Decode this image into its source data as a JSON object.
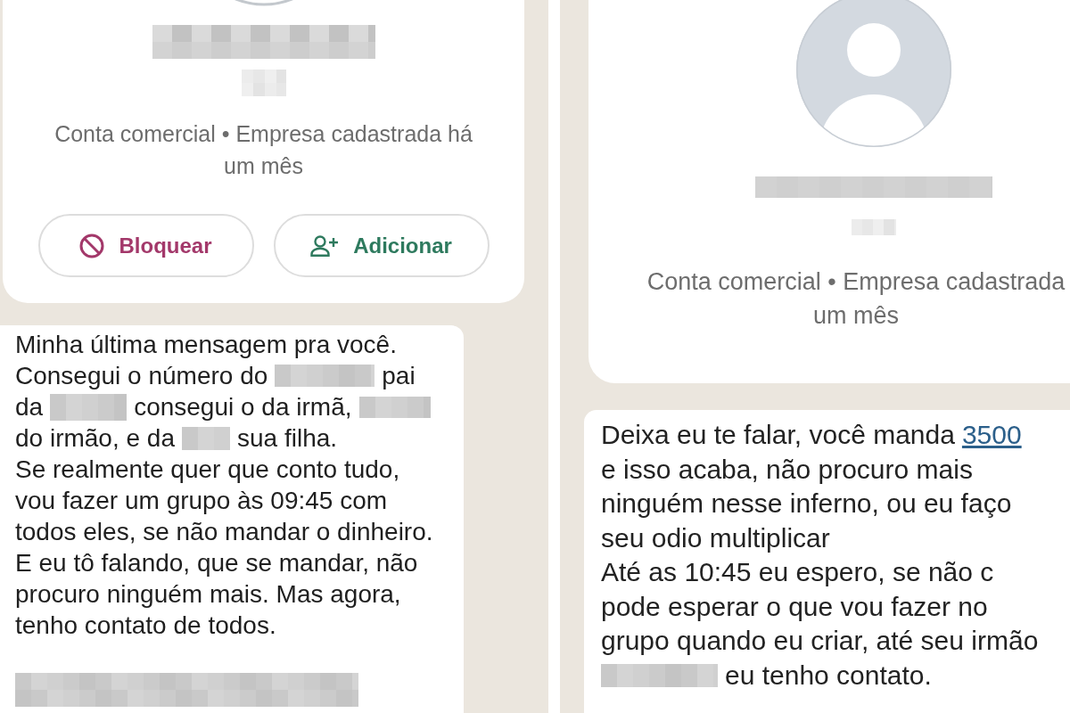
{
  "left_screen": {
    "profile_card": {
      "subtitle_lines": [
        "Conta comercial • Empresa cadastrada há",
        "um mês"
      ],
      "buttons": [
        {
          "kind": "block",
          "label": "Bloquear"
        },
        {
          "kind": "add",
          "label": "Adicionar"
        }
      ]
    },
    "message": {
      "lines": [
        [
          {
            "kind": "text",
            "text": "Minha última mensagem pra você."
          }
        ],
        [
          {
            "kind": "text",
            "text": "Consegui o número do"
          },
          {
            "kind": "redacted"
          },
          {
            "kind": "text",
            "text": "pai"
          }
        ],
        [
          {
            "kind": "text",
            "text": "da"
          },
          {
            "kind": "redacted"
          },
          {
            "kind": "text",
            "text": "consegui o da irmã,"
          },
          {
            "kind": "redacted"
          }
        ],
        [
          {
            "kind": "text",
            "text": "do irmão, e da"
          },
          {
            "kind": "redacted"
          },
          {
            "kind": "text",
            "text": "sua filha."
          }
        ],
        [
          {
            "kind": "text",
            "text": "Se realmente quer que conto tudo,"
          }
        ],
        [
          {
            "kind": "text",
            "text": "vou fazer um grupo às 09:45 com"
          }
        ],
        [
          {
            "kind": "text",
            "text": "todos eles, se não mandar o dinheiro."
          }
        ],
        [
          {
            "kind": "text",
            "text": "E eu tô falando, que se mandar, não"
          }
        ],
        [
          {
            "kind": "text",
            "text": "procuro ninguém mais. Mas agora,"
          }
        ],
        [
          {
            "kind": "text",
            "text": "tenho contato de todos."
          }
        ],
        [
          {
            "kind": "redacted"
          }
        ]
      ]
    }
  },
  "right_screen": {
    "profile_card": {
      "subtitle_lines": [
        "Conta comercial • Empresa cadastrada",
        "um mês"
      ]
    },
    "message": {
      "lines": [
        [
          {
            "kind": "text",
            "text": "Deixa eu te falar, você manda"
          },
          {
            "kind": "link",
            "text": "3500"
          }
        ],
        [
          {
            "kind": "text",
            "text": "e isso acaba, não procuro mais"
          }
        ],
        [
          {
            "kind": "text",
            "text": "ninguém nesse inferno, ou eu faço"
          }
        ],
        [
          {
            "kind": "text",
            "text": "seu odio multiplicar"
          }
        ],
        [
          {
            "kind": "text",
            "text": "Até as 10:45 eu espero, se não c"
          }
        ],
        [
          {
            "kind": "text",
            "text": "pode esperar o que vou fazer no"
          }
        ],
        [
          {
            "kind": "text",
            "text": "grupo quando eu criar, até seu irmão"
          }
        ],
        [
          {
            "kind": "redacted"
          },
          {
            "kind": "text",
            "text": "eu tenho contato."
          }
        ]
      ]
    }
  }
}
